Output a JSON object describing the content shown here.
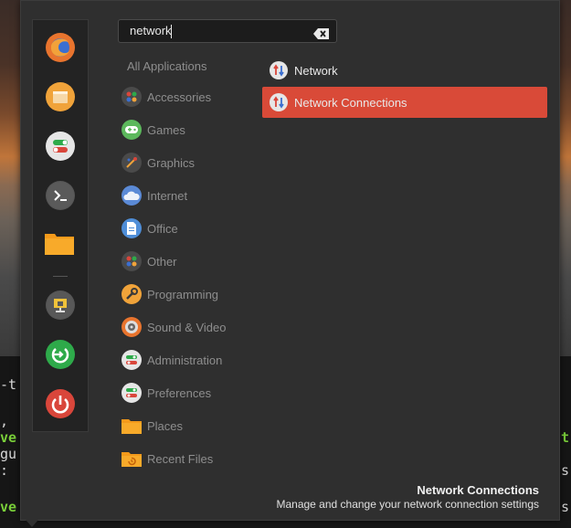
{
  "search": {
    "value": "network"
  },
  "favorites": [
    {
      "name": "firefox-icon"
    },
    {
      "name": "notes-icon"
    },
    {
      "name": "settings-toggle-icon"
    },
    {
      "name": "terminal-icon"
    },
    {
      "name": "folder-icon"
    },
    {
      "name": "lock-screen-icon"
    },
    {
      "name": "logout-icon"
    },
    {
      "name": "power-icon"
    }
  ],
  "categories": {
    "all": "All Applications",
    "items": [
      {
        "label": "Accessories",
        "icon": "accessories-icon"
      },
      {
        "label": "Games",
        "icon": "games-icon"
      },
      {
        "label": "Graphics",
        "icon": "graphics-icon"
      },
      {
        "label": "Internet",
        "icon": "internet-icon"
      },
      {
        "label": "Office",
        "icon": "office-icon"
      },
      {
        "label": "Other",
        "icon": "other-icon"
      },
      {
        "label": "Programming",
        "icon": "programming-icon"
      },
      {
        "label": "Sound & Video",
        "icon": "sound-video-icon"
      },
      {
        "label": "Administration",
        "icon": "administration-icon"
      },
      {
        "label": "Preferences",
        "icon": "preferences-icon"
      },
      {
        "label": "Places",
        "icon": "places-icon"
      },
      {
        "label": "Recent Files",
        "icon": "recent-files-icon"
      }
    ]
  },
  "results": [
    {
      "label": "Network",
      "selected": false
    },
    {
      "label": "Network Connections",
      "selected": true
    }
  ],
  "footer": {
    "title": "Network Connections",
    "description": "Manage and change your network connection settings"
  },
  "terminal": {
    "left_lines": [
      "-t",
      "",
      ",",
      "ve",
      "gu",
      ":",
      "",
      "ve"
    ],
    "right_lines": [
      "t",
      "s",
      "s"
    ]
  },
  "colors": {
    "accent": "#d94a38",
    "menu_bg": "#2f2f2f",
    "category_text": "#8e8e8e"
  }
}
